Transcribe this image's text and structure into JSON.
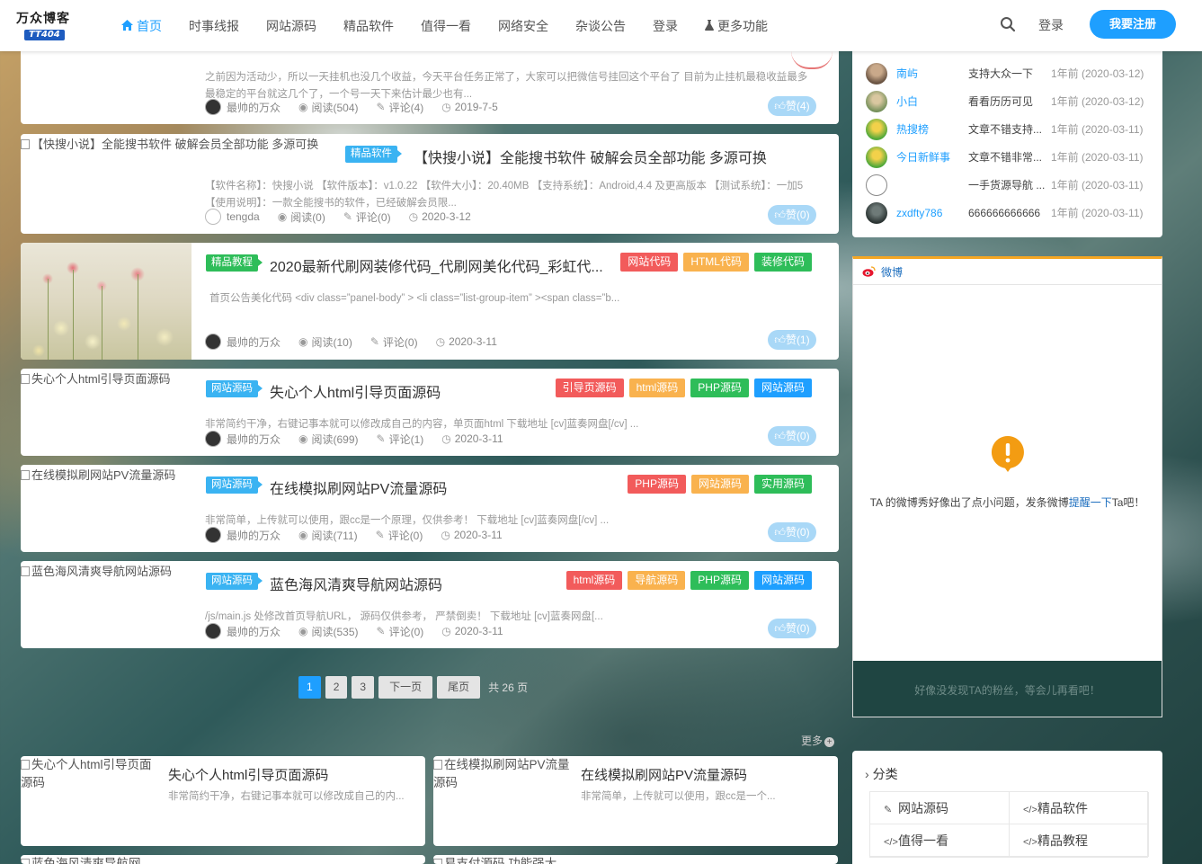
{
  "header": {
    "logo_line1": "万众博客",
    "logo_line2": "TT404",
    "nav": [
      {
        "label": "首页",
        "active": true
      },
      {
        "label": "时事线报"
      },
      {
        "label": "网站源码"
      },
      {
        "label": "精品软件"
      },
      {
        "label": "值得一看"
      },
      {
        "label": "网络安全"
      },
      {
        "label": "杂谈公告"
      },
      {
        "label": "登录"
      },
      {
        "label": "更多功能"
      }
    ],
    "login_label": "登录",
    "register_label": "我要注册"
  },
  "posts": [
    {
      "excerpt": "之前因为活动少，所以一天挂机也没几个收益，今天平台任务正常了，大家可以把微信号挂回这个平台了 目前为止挂机最稳收益最多最稳定的平台就这几个了，一个号一天下来估计最少也有...",
      "author": "最帅的万众",
      "views": "阅读(504)",
      "comments": "评论(4)",
      "date": "2019-7-5",
      "likes": "赞(4)"
    },
    {
      "image_alt": "【快搜小说】全能搜书软件 破解会员全部功能 多源可换",
      "category": "精品软件",
      "title": "【快搜小说】全能搜书软件 破解会员全部功能 多源可换",
      "excerpt": "【软件名称】：快搜小说 【软件版本】：v1.0.22 【软件大小】：20.40MB 【支持系统】：Android,4.4 及更高版本 【测试系统】：一加5 【使用说明】：一款全能搜书的软件，已经破解会员限...",
      "author": "tengda",
      "views": "阅读(0)",
      "comments": "评论(0)",
      "date": "2020-3-12",
      "likes": "赞(0)"
    },
    {
      "category": "精品教程",
      "title": "2020最新代刷网装修代码_代刷网美化代码_彩虹代...",
      "tags": [
        {
          "label": "网站代码",
          "color": "#f25b5b"
        },
        {
          "label": "HTML代码",
          "color": "#f9b24e"
        },
        {
          "label": "装修代码",
          "color": "#2ebd59"
        }
      ],
      "excerpt": "首页公告美化代码 <div class=”panel-body” > <li class=”list-group-item” ><span class=”b...",
      "author": "最帅的万众",
      "views": "阅读(10)",
      "comments": "评论(0)",
      "date": "2020-3-11",
      "likes": "赞(1)"
    },
    {
      "image_alt": "失心个人html引导页面源码",
      "category": "网站源码",
      "title": "失心个人html引导页面源码",
      "tags": [
        {
          "label": "引导页源码",
          "color": "#f25b5b"
        },
        {
          "label": "html源码",
          "color": "#f9b24e"
        },
        {
          "label": "PHP源码",
          "color": "#2ebd59"
        },
        {
          "label": "网站源码",
          "color": "#1e9fff"
        }
      ],
      "excerpt": "非常简约干净，右键记事本就可以修改成自己的内容，单页面html 下载地址 [cv]蓝奏网盘[/cv] ...",
      "author": "最帅的万众",
      "views": "阅读(699)",
      "comments": "评论(1)",
      "date": "2020-3-11",
      "likes": "赞(0)"
    },
    {
      "image_alt": "在线模拟刷网站PV流量源码",
      "category": "网站源码",
      "title": "在线模拟刷网站PV流量源码",
      "tags": [
        {
          "label": "PHP源码",
          "color": "#f25b5b"
        },
        {
          "label": "网站源码",
          "color": "#f9b24e"
        },
        {
          "label": "实用源码",
          "color": "#2ebd59"
        }
      ],
      "excerpt": "非常简单，上传就可以使用，跟cc是一个原理，仅供参考！ 下载地址 [cv]蓝奏网盘[/cv] ...",
      "author": "最帅的万众",
      "views": "阅读(711)",
      "comments": "评论(0)",
      "date": "2020-3-11",
      "likes": "赞(0)"
    },
    {
      "image_alt": "蓝色海风清爽导航网站源码",
      "category": "网站源码",
      "title": "蓝色海风清爽导航网站源码",
      "tags": [
        {
          "label": "html源码",
          "color": "#f25b5b"
        },
        {
          "label": "导航源码",
          "color": "#f9b24e"
        },
        {
          "label": "PHP源码",
          "color": "#2ebd59"
        },
        {
          "label": "网站源码",
          "color": "#1e9fff"
        }
      ],
      "excerpt": "/js/main.js 处修改首页导航URL， 源码仅供参考， 严禁倒卖！ 下载地址 [cv]蓝奏网盘[...",
      "author": "最帅的万众",
      "views": "阅读(535)",
      "comments": "评论(0)",
      "date": "2020-3-11",
      "likes": "赞(0)"
    }
  ],
  "pagination": {
    "pages": [
      "1",
      "2",
      "3"
    ],
    "current": "1",
    "next": "下一页",
    "last": "尾页",
    "total": "共 26 页"
  },
  "recommend": {
    "more_label": "更多",
    "items": [
      {
        "image_alt": "失心个人html引导页面源码",
        "title": "失心个人html引导页面源码",
        "excerpt": "非常简约干净，右键记事本就可以修改成自己的内..."
      },
      {
        "image_alt": "在线模拟刷网站PV流量源码",
        "title": "在线模拟刷网站PV流量源码",
        "excerpt": "非常简单，上传就可以使用，跟cc是一个..."
      },
      {
        "image_alt": "蓝色海风清爽导航网"
      },
      {
        "image_alt": "易支付源码 功能强大"
      }
    ]
  },
  "visitors": [
    {
      "name": "南屿",
      "msg": "支持大众一下",
      "time": "1年前 (2020-03-12)"
    },
    {
      "name": "小白",
      "msg": "看看历历可见",
      "time": "1年前 (2020-03-12)"
    },
    {
      "name": "热搜榜",
      "msg": "文章不错支持...",
      "time": "1年前 (2020-03-11)"
    },
    {
      "name": "今日新鲜事",
      "msg": "文章不错非常...",
      "time": "1年前 (2020-03-11)"
    },
    {
      "name": "",
      "msg": "一手货源导航 ...",
      "time": "1年前 (2020-03-11)"
    },
    {
      "name": "zxdfty786",
      "msg": "666666666666",
      "time": "1年前 (2020-03-11)"
    }
  ],
  "weibo": {
    "header": "微博",
    "msg_prefix": "TA 的微博秀好像出了点小问题，发条微博",
    "msg_link": "提醒一下",
    "msg_suffix": "Ta吧！",
    "footer": "好像没发现TA的粉丝，等会儿再看吧！"
  },
  "categories": {
    "header": "分类",
    "items": [
      "网站源码",
      "精品软件",
      "值得一看",
      "精品教程"
    ]
  }
}
